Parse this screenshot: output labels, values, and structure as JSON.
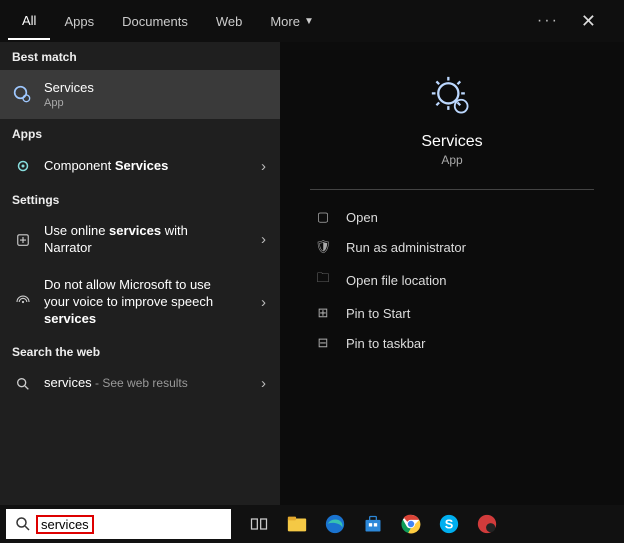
{
  "tabs": {
    "all": "All",
    "apps": "Apps",
    "documents": "Documents",
    "web": "Web",
    "more": "More"
  },
  "sections": {
    "best_match": "Best match",
    "apps": "Apps",
    "settings": "Settings",
    "search_web": "Search the web"
  },
  "best": {
    "title": "Services",
    "subtitle": "App"
  },
  "apps_list": {
    "component_pre": "Component ",
    "component_bold": "Services"
  },
  "settings_list": {
    "narrator_pre": "Use online ",
    "narrator_bold": "services",
    "narrator_post": " with Narrator",
    "speech_line1": "Do not allow Microsoft to use your voice to improve speech ",
    "speech_bold": "services"
  },
  "web": {
    "term": "services",
    "dash": " - ",
    "see_results": "See web results"
  },
  "hero": {
    "title": "Services",
    "subtitle": "App"
  },
  "actions": {
    "open": "Open",
    "run_admin": "Run as administrator",
    "file_loc": "Open file location",
    "pin_start": "Pin to Start",
    "pin_taskbar": "Pin to taskbar"
  },
  "search_value": "services"
}
